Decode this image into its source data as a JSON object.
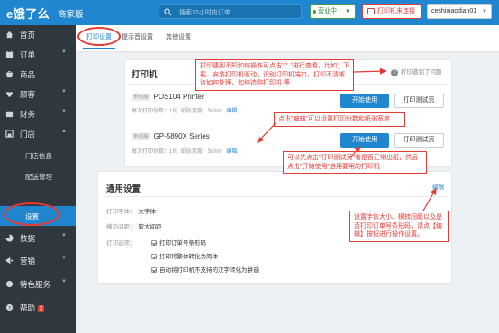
{
  "header": {
    "logo": "e饿了么",
    "logo_sub": "商家版",
    "search_placeholder": "搜索12小时内订单",
    "business_status": "营业中",
    "printer_status": "打印机未连接",
    "user": "ceshixiaodian01"
  },
  "sidebar": {
    "items": [
      {
        "label": "首页",
        "icon": "home-icon"
      },
      {
        "label": "订单",
        "icon": "order-icon"
      },
      {
        "label": "商品",
        "icon": "goods-icon"
      },
      {
        "label": "顾客",
        "icon": "customer-icon"
      },
      {
        "label": "财务",
        "icon": "finance-icon"
      },
      {
        "label": "门店",
        "icon": "store-icon"
      }
    ],
    "sub_items": [
      "门店信息",
      "配送管理",
      "设置"
    ],
    "items2": [
      {
        "label": "数据",
        "icon": "data-icon"
      },
      {
        "label": "营销",
        "icon": "marketing-icon"
      },
      {
        "label": "特色服务",
        "icon": "service-icon"
      },
      {
        "label": "帮助",
        "icon": "help-icon",
        "badge": "2"
      }
    ]
  },
  "tabs": [
    "打印设置",
    "提示音设置",
    "其他设置"
  ],
  "printer_card": {
    "title": "打印机",
    "help": "打印遇到了问题",
    "printers": [
      {
        "tag": "未连接",
        "name": "POS104 Printer",
        "copies_label": "每次打印份数：",
        "copies": "1份",
        "width_label": "纸张宽度：",
        "width": "58mm",
        "edit": "编辑",
        "use": "开始使用",
        "test": "打印测试页"
      },
      {
        "tag": "未连接",
        "name": "GP-5890X Series",
        "copies_label": "每次打印份数：",
        "copies": "1份",
        "width_label": "纸张宽度：",
        "width": "58mm",
        "edit": "编辑",
        "use": "开始使用",
        "test": "打印测试页"
      }
    ]
  },
  "general_card": {
    "title": "通用设置",
    "edit": "编辑",
    "font_label": "打印字体：",
    "font_value": "大字体",
    "spacing_label": "横向间距：",
    "spacing_value": "较大间距",
    "options_label": "打印选项：",
    "options": [
      "打印订单号条形码",
      "打印将繁体转化为简体",
      "自动将打印机不支持的汉字转化为拼音"
    ]
  },
  "annotations": {
    "top": "打印遇到不知如何操作可点击\"？\"进行查看，比如：下载、安装打印机驱动，识别打印机端口，打印不清晰该如何处理，如何选购打印机 等",
    "edit": "点击\"编辑\"可以设置打印份数和纸张宽度",
    "test": "可以先点击\"打印测试页\"看是否正常出纸，然后点击\"开始使用\"启用要用的打印机",
    "general": "设置字体大小、横转间距以及是否打印订单号条形码，请点【编辑】按钮进行操作设置。"
  },
  "colors": {
    "brand": "#1f86cf",
    "sidebar": "#30383f",
    "annotation": "#e53b34"
  }
}
